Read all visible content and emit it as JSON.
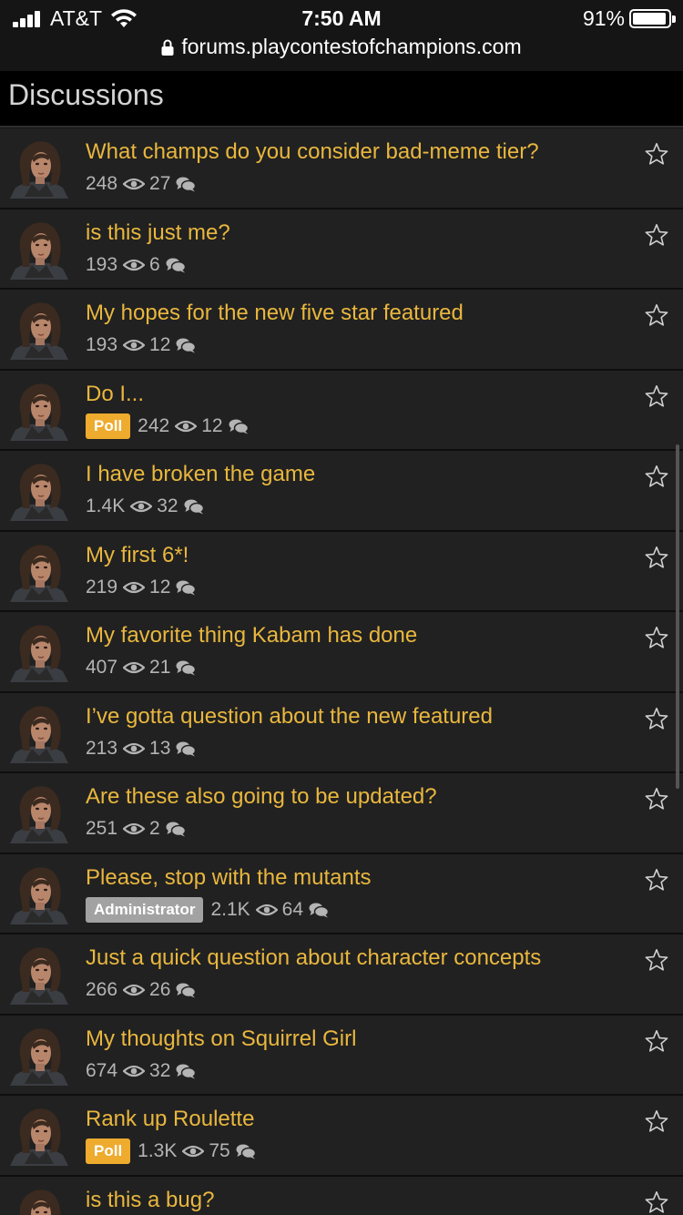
{
  "status_bar": {
    "carrier": "AT&T",
    "time": "7:50 AM",
    "battery": "91%"
  },
  "browser": {
    "url": "forums.playcontestofchampions.com"
  },
  "page": {
    "title": "Discussions"
  },
  "colors": {
    "title": "#e9b73e",
    "poll_badge": "#eeab2e",
    "admin_badge": "#a2a2a2",
    "row_bg": "#212121"
  },
  "discussions": [
    {
      "title": "What champs do you consider bad-meme tier?",
      "badge": "",
      "views": "248",
      "comments": "27"
    },
    {
      "title": "is this just me?",
      "badge": "",
      "views": "193",
      "comments": "6"
    },
    {
      "title": "My hopes for the new five star featured",
      "badge": "",
      "views": "193",
      "comments": "12"
    },
    {
      "title": "Do I...",
      "badge": "Poll",
      "views": "242",
      "comments": "12"
    },
    {
      "title": "I have broken the game",
      "badge": "",
      "views": "1.4K",
      "comments": "32"
    },
    {
      "title": "My first 6*!",
      "badge": "",
      "views": "219",
      "comments": "12"
    },
    {
      "title": "My favorite thing Kabam has done",
      "badge": "",
      "views": "407",
      "comments": "21"
    },
    {
      "title": "I’ve gotta question about the new featured",
      "badge": "",
      "views": "213",
      "comments": "13"
    },
    {
      "title": "Are these also going to be updated?",
      "badge": "",
      "views": "251",
      "comments": "2"
    },
    {
      "title": "Please, stop with the mutants",
      "badge": "Administrator",
      "views": "2.1K",
      "comments": "64"
    },
    {
      "title": "Just a quick question about character concepts",
      "badge": "",
      "views": "266",
      "comments": "26"
    },
    {
      "title": "My thoughts on Squirrel Girl",
      "badge": "",
      "views": "674",
      "comments": "32"
    },
    {
      "title": "Rank up Roulette",
      "badge": "Poll",
      "views": "1.3K",
      "comments": "75"
    },
    {
      "title": "is this a bug?",
      "badge": "",
      "views": "",
      "comments": ""
    }
  ]
}
